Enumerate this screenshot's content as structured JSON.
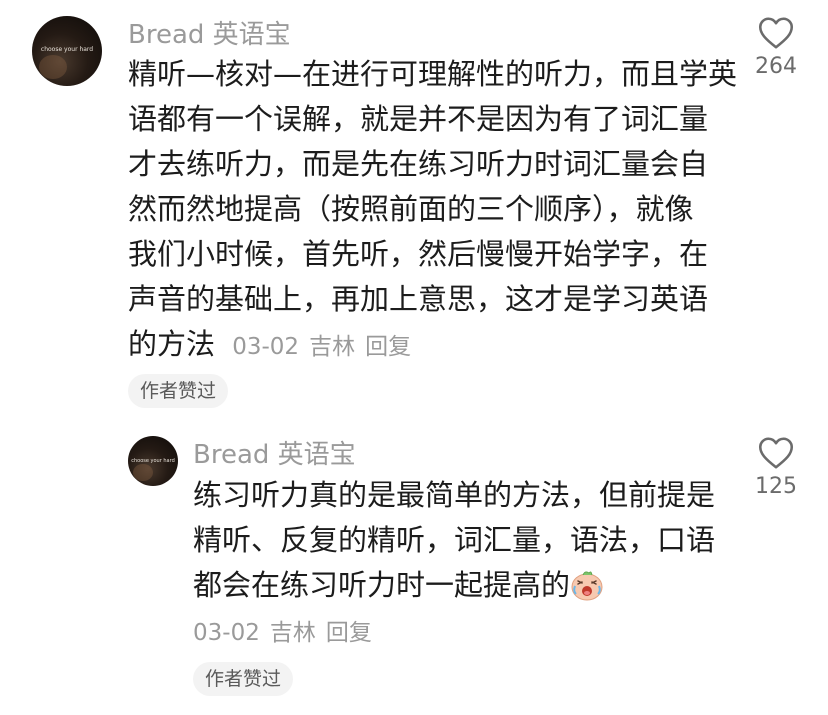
{
  "comments": [
    {
      "avatar_text": "choose your hard",
      "username": "Bread 英语宝",
      "lines": [
        "精听—核对—在进行可理解性的听力，而且学英",
        "语都有一个误解，就是并不是因为有了词汇量",
        "才去练听力，而是先在练习听力时词汇量会自",
        "然而然地提高（按照前面的三个顺序），就像",
        "我们小时候，首先听，然后慢慢开始学字，在",
        "声音的基础上，再加上意思，这才是学习英语",
        "的方法"
      ],
      "date": "03-02",
      "location": "吉林",
      "reply_label": "回复",
      "like_count": "264",
      "badge": "作者赞过"
    },
    {
      "avatar_text": "choose your hard",
      "username": "Bread 英语宝",
      "lines": [
        "练习听力真的是最简单的方法，但前提是",
        "精听、反复的精听，词汇量，语法，口语",
        "都会在练习听力时一起提高的"
      ],
      "emoji": "laughing-cry-face-icon",
      "date": "03-02",
      "location": "吉林",
      "reply_label": "回复",
      "like_count": "125",
      "badge": "作者赞过"
    }
  ]
}
